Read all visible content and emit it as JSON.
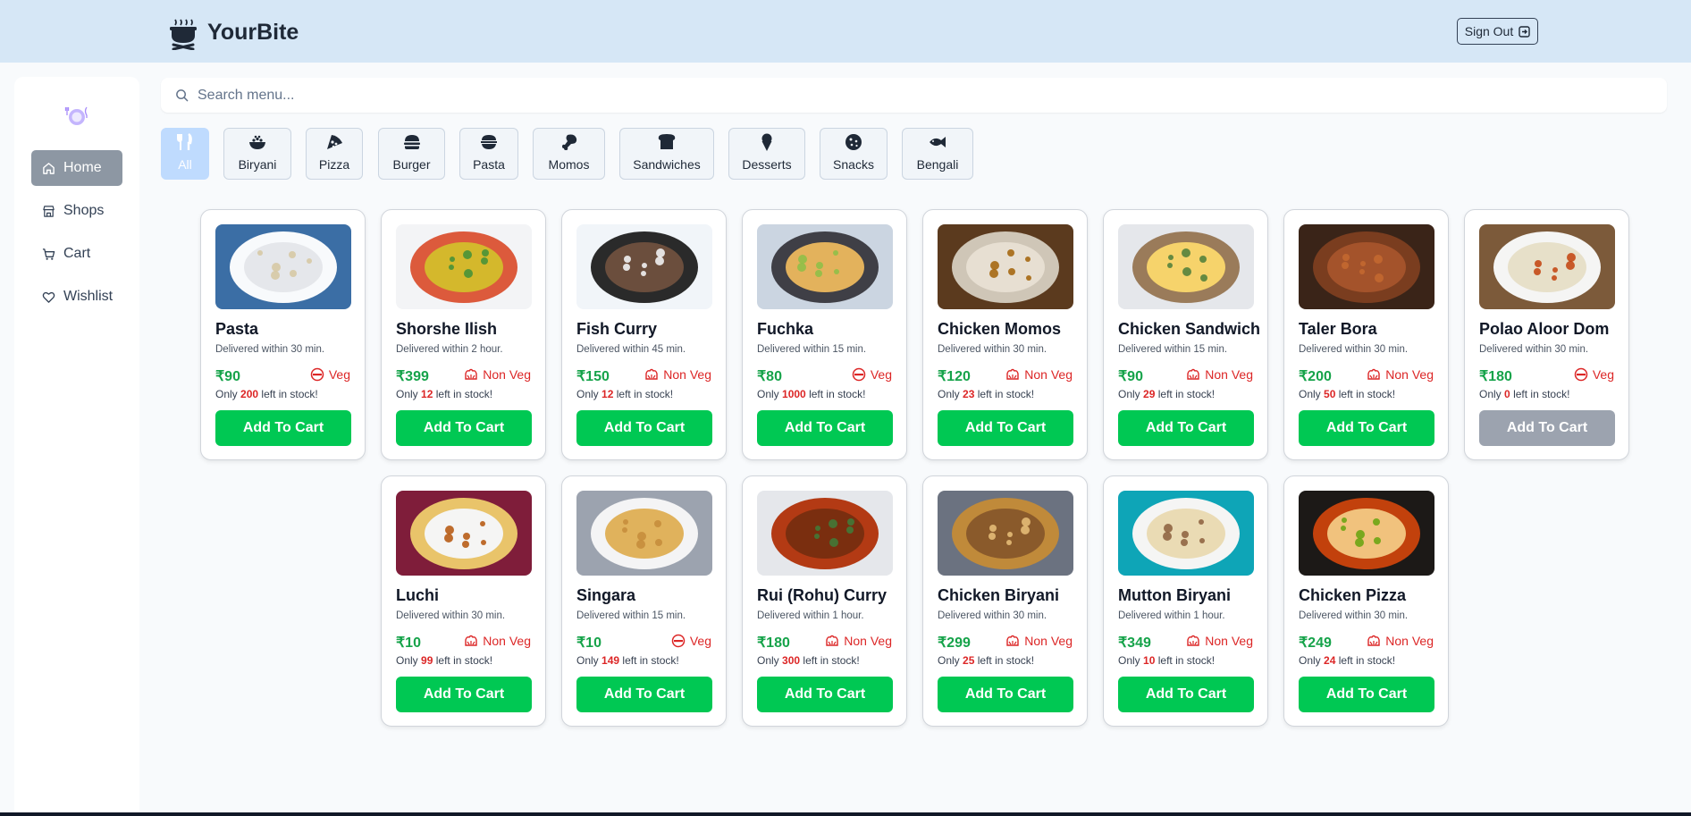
{
  "brand": {
    "name": "YourBite"
  },
  "header": {
    "sign_out": "Sign Out"
  },
  "sidebar": {
    "items": [
      {
        "label": "Home",
        "icon": "home-icon",
        "active": true
      },
      {
        "label": "Shops",
        "icon": "store-icon"
      },
      {
        "label": "Cart",
        "icon": "cart-icon"
      },
      {
        "label": "Wishlist",
        "icon": "heart-icon"
      }
    ]
  },
  "search": {
    "placeholder": "Search menu..."
  },
  "categories": [
    {
      "label": "All",
      "icon": "utensils-icon",
      "active": true
    },
    {
      "label": "Biryani",
      "icon": "rice-bowl-icon"
    },
    {
      "label": "Pizza",
      "icon": "pizza-icon"
    },
    {
      "label": "Burger",
      "icon": "burger-icon"
    },
    {
      "label": "Pasta",
      "icon": "bowl-icon"
    },
    {
      "label": "Momos",
      "icon": "drumstick-icon"
    },
    {
      "label": "Sandwiches",
      "icon": "bread-icon"
    },
    {
      "label": "Desserts",
      "icon": "ice-cream-icon"
    },
    {
      "label": "Snacks",
      "icon": "cookie-icon"
    },
    {
      "label": "Bengali",
      "icon": "fish-icon"
    }
  ],
  "colors": {
    "accent_green": "#00c853",
    "price_green": "#16a34a",
    "stock_red": "#dc2626",
    "header_bg": "#d6e7f6",
    "disabled_gray": "#9ca3af"
  },
  "currency": "₹",
  "items": [
    {
      "name": "Pasta",
      "delivery": "Delivered within 30 min.",
      "price": "₹90",
      "diet": "Veg",
      "stock_prefix": "Only",
      "stock": "200",
      "stock_suffix": "left in stock!",
      "button": "Add To Cart"
    },
    {
      "name": "Shorshe Ilish",
      "delivery": "Delivered within 2 hour.",
      "price": "₹399",
      "diet": "Non Veg",
      "stock_prefix": "Only",
      "stock": "12",
      "stock_suffix": "left in stock!",
      "button": "Add To Cart"
    },
    {
      "name": "Fish Curry",
      "delivery": "Delivered within 45 min.",
      "price": "₹150",
      "diet": "Non Veg",
      "stock_prefix": "Only",
      "stock": "12",
      "stock_suffix": "left in stock!",
      "button": "Add To Cart"
    },
    {
      "name": "Fuchka",
      "delivery": "Delivered within 15 min.",
      "price": "₹80",
      "diet": "Veg",
      "stock_prefix": "Only",
      "stock": "1000",
      "stock_suffix": "left in stock!",
      "button": "Add To Cart"
    },
    {
      "name": "Chicken Momos",
      "delivery": "Delivered within 30 min.",
      "price": "₹120",
      "diet": "Non Veg",
      "stock_prefix": "Only",
      "stock": "23",
      "stock_suffix": "left in stock!",
      "button": "Add To Cart"
    },
    {
      "name": "Chicken Sandwich",
      "delivery": "Delivered within 15 min.",
      "price": "₹90",
      "diet": "Non Veg",
      "stock_prefix": "Only",
      "stock": "29",
      "stock_suffix": "left in stock!",
      "button": "Add To Cart"
    },
    {
      "name": "Taler Bora",
      "delivery": "Delivered within 30 min.",
      "price": "₹200",
      "diet": "Non Veg",
      "stock_prefix": "Only",
      "stock": "50",
      "stock_suffix": "left in stock!",
      "button": "Add To Cart"
    },
    {
      "name": "Polao Aloor Dom",
      "delivery": "Delivered within 30 min.",
      "price": "₹180",
      "diet": "Veg",
      "stock_prefix": "Only",
      "stock": "0",
      "stock_suffix": "left in stock!",
      "button": "Add To Cart",
      "disabled": true
    },
    {
      "name": "Luchi",
      "delivery": "Delivered within 30 min.",
      "price": "₹10",
      "diet": "Non Veg",
      "stock_prefix": "Only",
      "stock": "99",
      "stock_suffix": "left in stock!",
      "button": "Add To Cart"
    },
    {
      "name": "Singara",
      "delivery": "Delivered within 15 min.",
      "price": "₹10",
      "diet": "Veg",
      "stock_prefix": "Only",
      "stock": "149",
      "stock_suffix": "left in stock!",
      "button": "Add To Cart"
    },
    {
      "name": "Rui (Rohu) Curry",
      "delivery": "Delivered within 1 hour.",
      "price": "₹180",
      "diet": "Non Veg",
      "stock_prefix": "Only",
      "stock": "300",
      "stock_suffix": "left in stock!",
      "button": "Add To Cart"
    },
    {
      "name": "Chicken Biryani",
      "delivery": "Delivered within 30 min.",
      "price": "₹299",
      "diet": "Non Veg",
      "stock_prefix": "Only",
      "stock": "25",
      "stock_suffix": "left in stock!",
      "button": "Add To Cart"
    },
    {
      "name": "Mutton Biryani",
      "delivery": "Delivered within 1 hour.",
      "price": "₹349",
      "diet": "Non Veg",
      "stock_prefix": "Only",
      "stock": "10",
      "stock_suffix": "left in stock!",
      "button": "Add To Cart"
    },
    {
      "name": "Chicken Pizza",
      "delivery": "Delivered within 30 min.",
      "price": "₹249",
      "diet": "Non Veg",
      "stock_prefix": "Only",
      "stock": "24",
      "stock_suffix": "left in stock!",
      "button": "Add To Cart"
    }
  ]
}
